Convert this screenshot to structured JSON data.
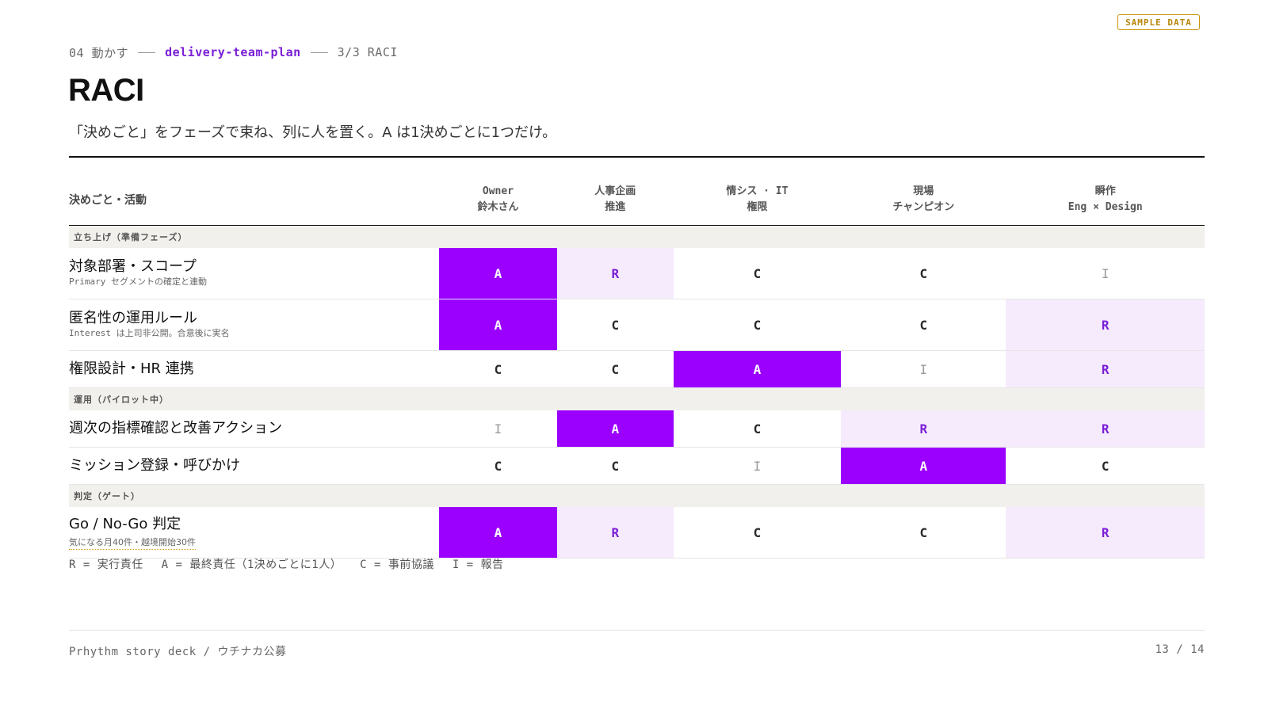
{
  "badge": "SAMPLE DATA",
  "breadcrumb": {
    "section": "04 動かす",
    "plan": "delivery-team-plan",
    "step": "3/3 RACI"
  },
  "title": "RACI",
  "subtitle": "「決めごと」をフェーズで束ね、列に人を置く。A は1決めごとに1つだけ。",
  "table": {
    "activity_header": "決めごと・活動",
    "columns": [
      {
        "line1": "Owner",
        "line2": "鈴木さん"
      },
      {
        "line1": "人事企画",
        "line2": "推進"
      },
      {
        "line1": "情シス · IT",
        "line2": "権限"
      },
      {
        "line1": "現場",
        "line2": "チャンピオン"
      },
      {
        "line1": "瞬作",
        "line2": "Eng × Design"
      }
    ],
    "phases": [
      {
        "name": "立ち上げ（準備フェーズ）",
        "rows": [
          {
            "title": "対象部署・スコープ",
            "sub": "Primary セグメントの確定と連動",
            "cells": [
              "A",
              "R",
              "C",
              "C",
              "I"
            ]
          },
          {
            "title": "匿名性の運用ルール",
            "sub": "Interest は上司非公開。合意後に実名",
            "cells": [
              "A",
              "C",
              "C",
              "C",
              "R"
            ]
          },
          {
            "title": "権限設計・HR 連携",
            "sub": "",
            "cells": [
              "C",
              "C",
              "A",
              "I",
              "R"
            ]
          }
        ]
      },
      {
        "name": "運用（パイロット中）",
        "rows": [
          {
            "title": "週次の指標確認と改善アクション",
            "sub": "",
            "cells": [
              "I",
              "A",
              "C",
              "R",
              "R"
            ]
          },
          {
            "title": "ミッション登録・呼びかけ",
            "sub": "",
            "cells": [
              "C",
              "C",
              "I",
              "A",
              "C"
            ]
          }
        ]
      },
      {
        "name": "判定（ゲート）",
        "rows": [
          {
            "title": "Go / No-Go 判定",
            "sub": "気になる月40件・越境開始30件",
            "cells": [
              "A",
              "R",
              "C",
              "C",
              "R"
            ]
          }
        ]
      }
    ]
  },
  "legend": [
    "R = 実行責任",
    "A = 最終責任（1決めごとに1人）",
    "C = 事前協議",
    "I = 報告"
  ],
  "footer": {
    "left": "Prhythm story deck / ウチナカ公募",
    "right": "13 / 14"
  },
  "colors": {
    "accent": "#9b00ff",
    "accent_text": "#7a1fd6",
    "responsible_bg": "#f6ebfc",
    "badge": "#c9950c",
    "phase_bg": "#f1f0ed"
  }
}
